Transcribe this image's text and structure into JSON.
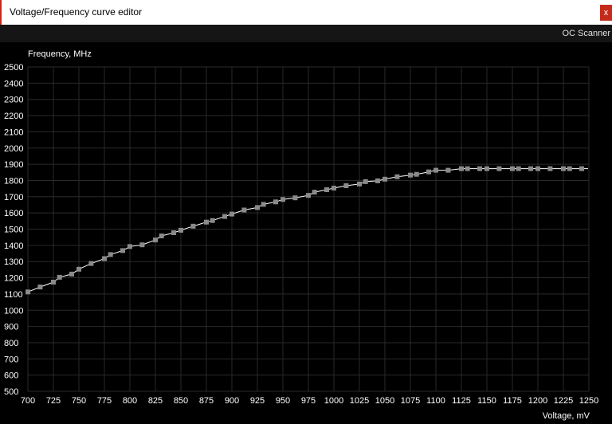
{
  "window": {
    "title": "Voltage/Frequency curve editor",
    "close_label": "x"
  },
  "toolbar": {
    "oc_scanner_label": "OC Scanner"
  },
  "colors": {
    "background": "#000000",
    "grid": "#2a2a2a",
    "curve": "#ffffff",
    "point": "#8a8a8a",
    "close": "#c42b1c"
  },
  "chart_data": {
    "type": "line",
    "title": "",
    "xlabel": "Voltage, mV",
    "ylabel": "Frequency, MHz",
    "xlim": [
      700,
      1250
    ],
    "ylim": [
      500,
      2500
    ],
    "x_ticks": [
      700,
      725,
      750,
      775,
      800,
      825,
      850,
      875,
      900,
      925,
      950,
      975,
      1000,
      1025,
      1050,
      1075,
      1100,
      1125,
      1150,
      1175,
      1200,
      1225,
      1250
    ],
    "y_ticks": [
      500,
      600,
      700,
      800,
      900,
      1000,
      1100,
      1200,
      1300,
      1400,
      1500,
      1600,
      1700,
      1800,
      1900,
      2000,
      2100,
      2200,
      2300,
      2400,
      2500
    ],
    "grid": true,
    "series": [
      {
        "x": [
          700,
          712,
          725,
          731,
          743,
          750,
          762,
          775,
          781,
          793,
          800,
          812,
          825,
          831,
          843,
          850,
          862,
          875,
          881,
          893,
          900,
          912,
          925,
          931,
          943,
          950,
          962,
          975,
          981,
          993,
          1000,
          1012,
          1025,
          1031,
          1043,
          1050,
          1062,
          1075,
          1081,
          1093,
          1100,
          1112,
          1125,
          1131,
          1143,
          1150,
          1162,
          1175,
          1181,
          1193,
          1200,
          1212,
          1225,
          1231,
          1243
        ],
        "y": [
          1113,
          1143,
          1173,
          1203,
          1223,
          1253,
          1288,
          1318,
          1343,
          1368,
          1393,
          1403,
          1433,
          1458,
          1478,
          1493,
          1518,
          1543,
          1553,
          1578,
          1593,
          1618,
          1633,
          1653,
          1668,
          1683,
          1693,
          1708,
          1728,
          1743,
          1753,
          1768,
          1778,
          1793,
          1798,
          1808,
          1823,
          1833,
          1838,
          1853,
          1863,
          1863,
          1873,
          1873,
          1873,
          1873,
          1873,
          1873,
          1873,
          1873,
          1873,
          1873,
          1873,
          1873,
          1873
        ]
      }
    ]
  }
}
